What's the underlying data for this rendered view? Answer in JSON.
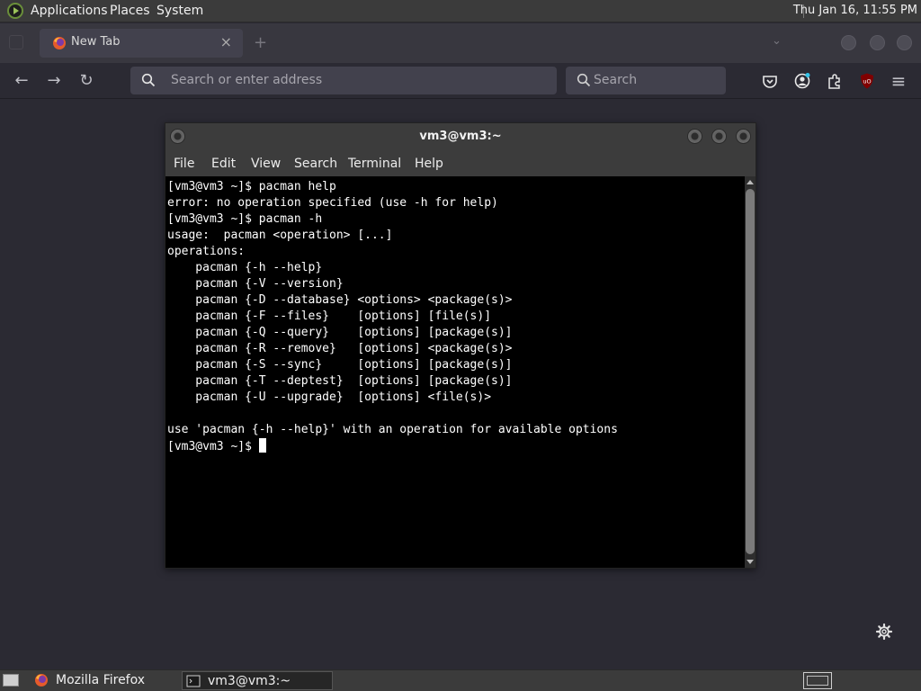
{
  "top_panel": {
    "menus": [
      "Applications",
      "Places",
      "System"
    ],
    "clock": "Thu Jan 16, 11:55 PM"
  },
  "browser": {
    "tab": {
      "title": "New Tab",
      "close": "×"
    },
    "new_tab": "+",
    "tabs_list": "⌄",
    "nav": {
      "back": "←",
      "forward": "→",
      "reload": "↻"
    },
    "urlbar_placeholder": "Search or enter address",
    "search_placeholder": "Search",
    "toolbar_icons": [
      "pocket-icon",
      "account-icon",
      "extensions-icon",
      "ublock-origin-icon",
      "menu-icon"
    ],
    "ublock_label": "uO",
    "menu_glyph": "≡"
  },
  "terminal": {
    "title": "vm3@vm3:~",
    "menus": [
      "File",
      "Edit",
      "View",
      "Search",
      "Terminal",
      "Help"
    ],
    "lines": [
      "[vm3@vm3 ~]$ pacman help",
      "error: no operation specified (use -h for help)",
      "[vm3@vm3 ~]$ pacman -h",
      "usage:  pacman <operation> [...]",
      "operations:",
      "    pacman {-h --help}",
      "    pacman {-V --version}",
      "    pacman {-D --database} <options> <package(s)>",
      "    pacman {-F --files}    [options] [file(s)]",
      "    pacman {-Q --query}    [options] [package(s)]",
      "    pacman {-R --remove}   [options] <package(s)>",
      "    pacman {-S --sync}     [options] [package(s)]",
      "    pacman {-T --deptest}  [options] [package(s)]",
      "    pacman {-U --upgrade}  [options] <file(s)>",
      "",
      "use 'pacman {-h --help}' with an operation for available options"
    ],
    "prompt": "[vm3@vm3 ~]$ "
  },
  "taskbar": {
    "tasks": [
      {
        "label": "Mozilla Firefox",
        "icon": "firefox-icon",
        "active": false
      },
      {
        "label": "vm3@vm3:~",
        "icon": "terminal-icon",
        "active": true
      }
    ]
  },
  "colors": {
    "panel": "#3b3b3b",
    "desktop": "#2b2a33",
    "terminal_bg": "#000000",
    "terminal_fg": "#ffffff"
  }
}
